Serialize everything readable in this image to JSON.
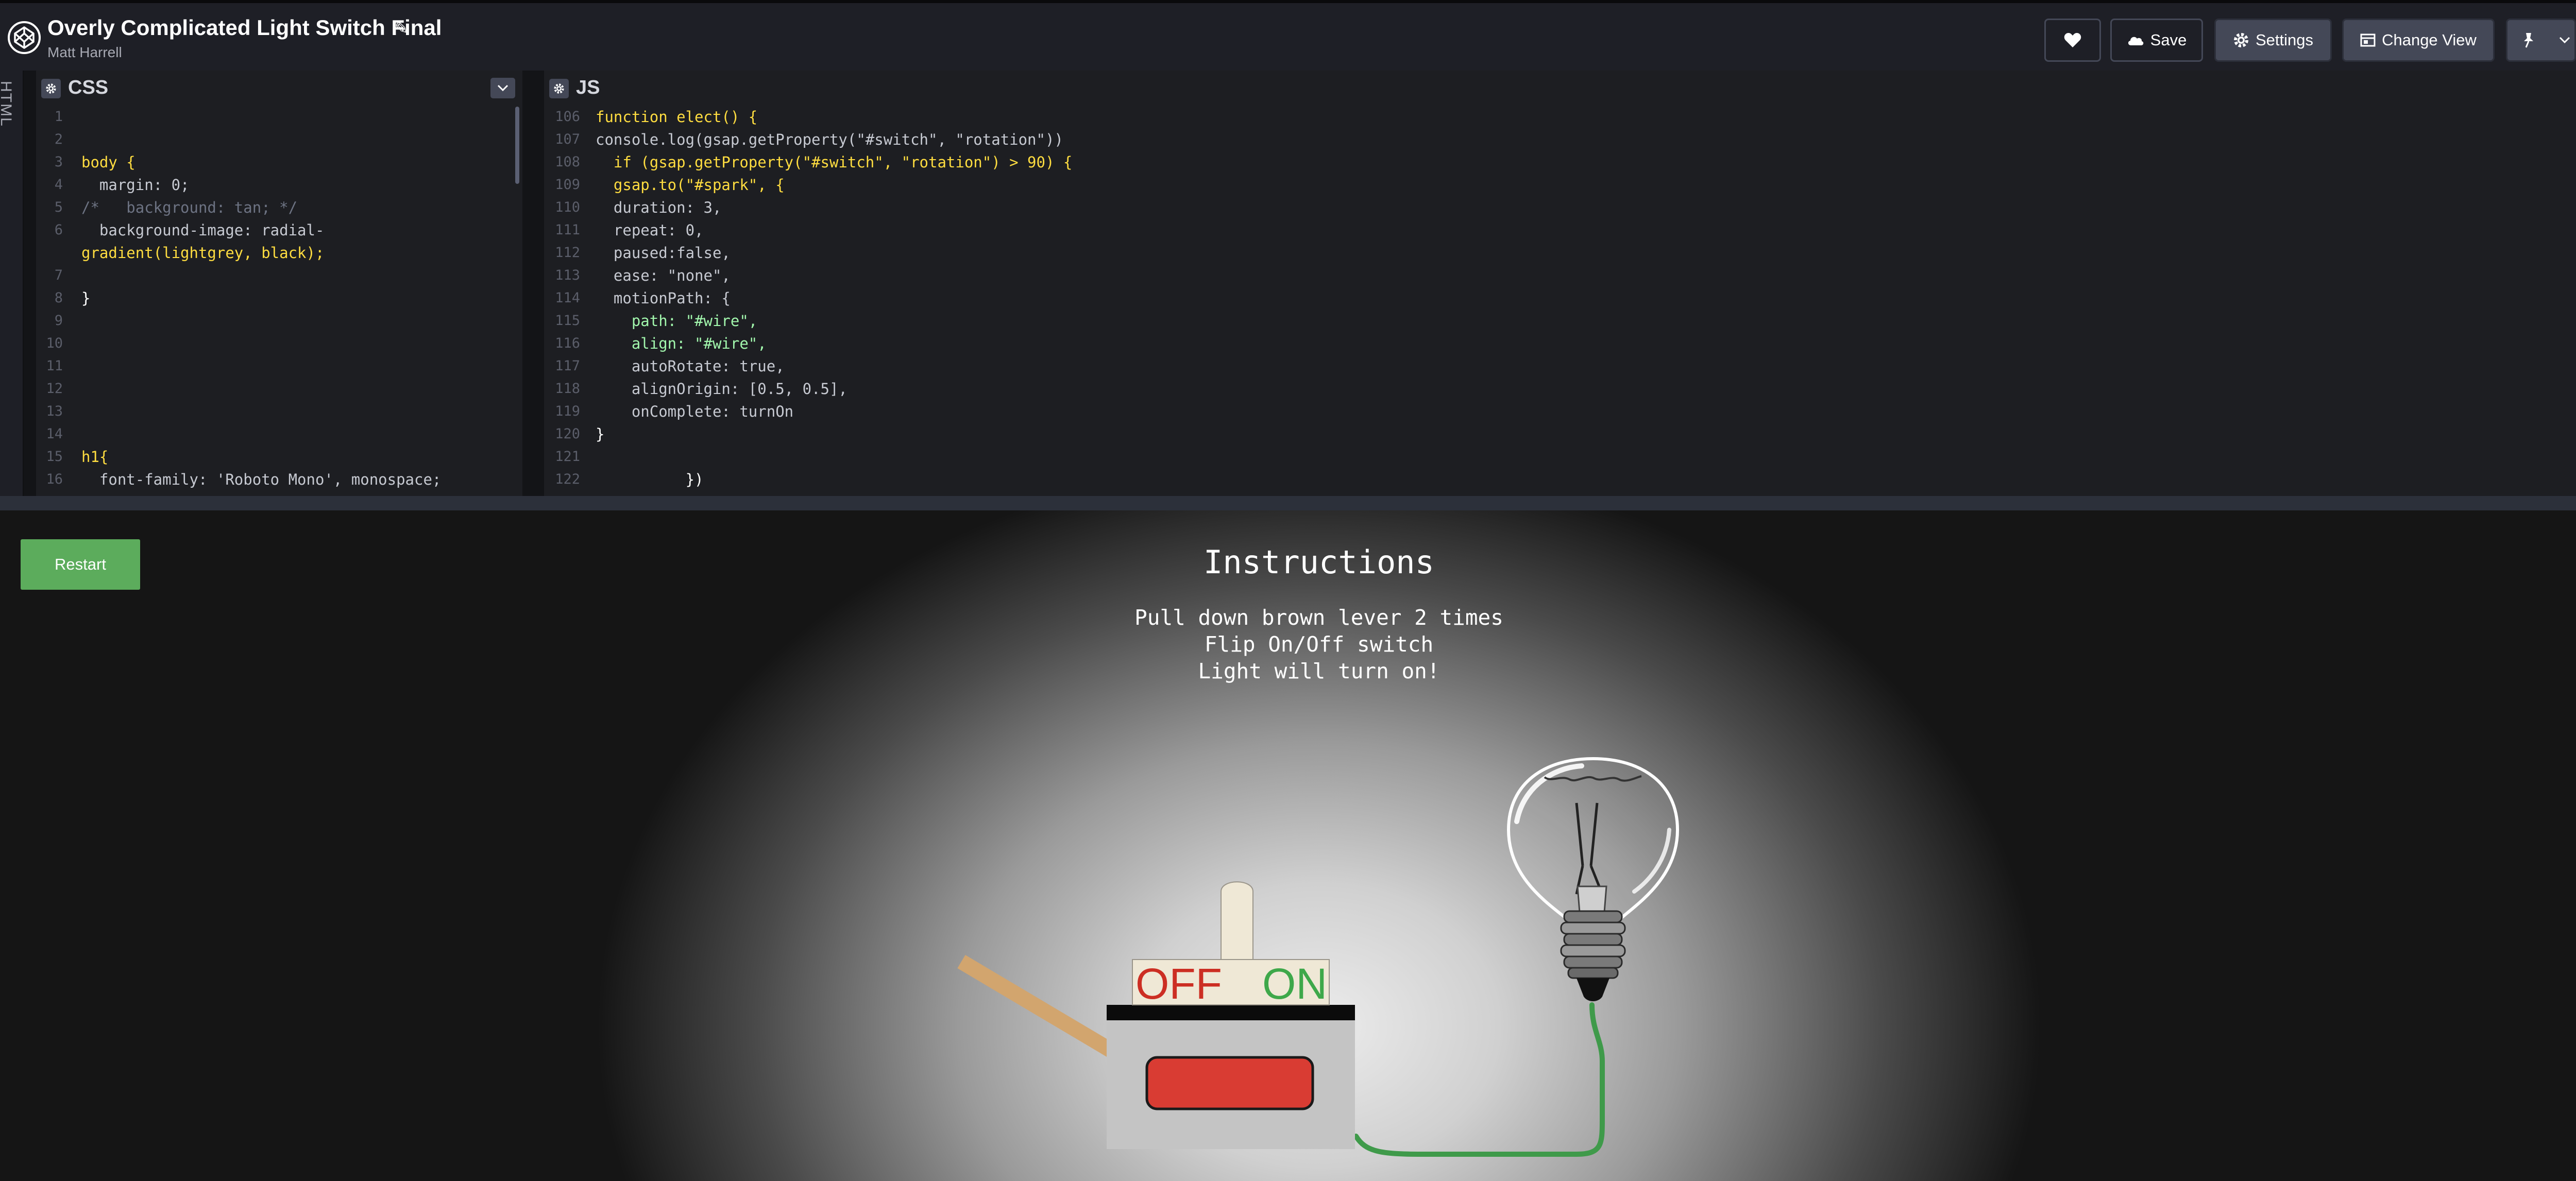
{
  "header": {
    "title": "Overly Complicated Light Switch Final",
    "author": "Matt Harrell",
    "buttons": {
      "save": "Save",
      "settings": "Settings",
      "change_view": "Change View"
    }
  },
  "editors": {
    "html_tab": "HTML",
    "css": {
      "label": "CSS",
      "lines": [
        "1",
        "2",
        "3",
        "4",
        "5",
        "6",
        "",
        "7",
        "8",
        "9",
        "10",
        "11",
        "12",
        "13",
        "14",
        "15",
        "16"
      ],
      "code": [
        "",
        "",
        "body {",
        "  margin: 0;",
        "/*   background: tan; */",
        "  background-image: radial-",
        "gradient(lightgrey, black);",
        "",
        "}",
        "",
        "",
        "",
        "",
        "",
        "h1{",
        "  font-family: 'Roboto Mono', monospace;"
      ]
    },
    "js": {
      "label": "JS",
      "lines": [
        "106",
        "107",
        "108",
        "109",
        "110",
        "111",
        "112",
        "113",
        "114",
        "115",
        "116",
        "117",
        "118",
        "119",
        "120",
        "121",
        "122"
      ],
      "code": [
        "function elect() {",
        "console.log(gsap.getProperty(\"#switch\", \"rotation\"))",
        "  if (gsap.getProperty(\"#switch\", \"rotation\") > 90) {",
        "  gsap.to(\"#spark\", {",
        "  duration: 3,",
        "  repeat: 0,",
        "  paused:false,",
        "  ease: \"none\",",
        "  motionPath: {",
        "    path: \"#wire\",",
        "    align: \"#wire\",",
        "    autoRotate: true,",
        "    alignOrigin: [0.5, 0.5],",
        "    onComplete: turnOn",
        "}",
        "",
        "          })"
      ]
    }
  },
  "preview": {
    "restart": "Restart",
    "instructions_title": "Instructions",
    "instructions": [
      "Pull down brown lever 2 times",
      "Flip On/Off switch",
      "Light will turn on!"
    ],
    "switch_off": "OFF",
    "switch_on": "ON"
  },
  "colors": {
    "accent_green": "#5cac5c",
    "switch_red": "#d93c33",
    "wire_green": "#3f9a4a",
    "lever_tan": "#d2a56e",
    "off_red": "#cc2e23",
    "on_green": "#3ea84a"
  }
}
